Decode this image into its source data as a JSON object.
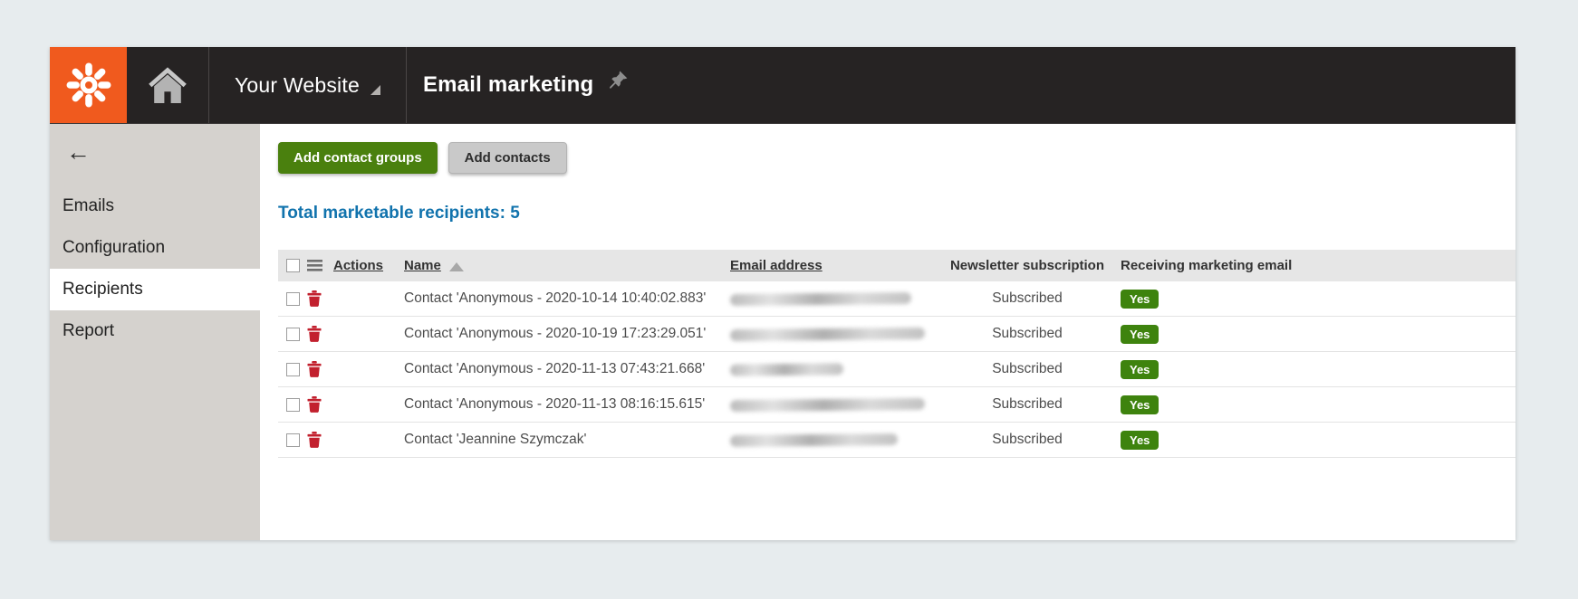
{
  "colors": {
    "brand_orange": "#f05a1e",
    "topbar_bg": "#262323",
    "page_bg": "#e7ecee",
    "sidebar_bg": "#d5d2ce",
    "primary_button_green": "#4a800e",
    "heading_blue": "#1173ad",
    "delete_red": "#c2202e",
    "badge_green": "#3e830e"
  },
  "topbar": {
    "logo_icon": "kentico-flower-icon",
    "home_icon": "home-icon",
    "site_selector_label": "Your Website",
    "app_title": "Email marketing",
    "pin_icon": "pin-icon"
  },
  "sidebar": {
    "back_icon_char": "←",
    "items": [
      {
        "label": "Emails",
        "active": false
      },
      {
        "label": "Configuration",
        "active": false
      },
      {
        "label": "Recipients",
        "active": true
      },
      {
        "label": "Report",
        "active": false
      }
    ]
  },
  "main": {
    "buttons": [
      {
        "label": "Add contact groups",
        "style": "primary"
      },
      {
        "label": "Add contacts",
        "style": "secondary"
      }
    ],
    "summary": "Total marketable recipients: 5",
    "table": {
      "headers": {
        "actions": "Actions",
        "name": "Name",
        "email": "Email address",
        "newsletter": "Newsletter subscription",
        "receiving": "Receiving marketing email"
      },
      "sort": {
        "column": "Name",
        "direction": "asc"
      },
      "rows": [
        {
          "name": "Contact 'Anonymous - 2020-10-14 10:40:02.883'",
          "email_redacted": true,
          "redaction_width": 200,
          "newsletter": "Subscribed",
          "receiving": "Yes"
        },
        {
          "name": "Contact 'Anonymous - 2020-10-19 17:23:29.051'",
          "email_redacted": true,
          "redaction_width": 215,
          "newsletter": "Subscribed",
          "receiving": "Yes"
        },
        {
          "name": "Contact 'Anonymous - 2020-11-13 07:43:21.668'",
          "email_redacted": true,
          "redaction_width": 125,
          "newsletter": "Subscribed",
          "receiving": "Yes"
        },
        {
          "name": "Contact 'Anonymous - 2020-11-13 08:16:15.615'",
          "email_redacted": true,
          "redaction_width": 215,
          "newsletter": "Subscribed",
          "receiving": "Yes"
        },
        {
          "name": "Contact 'Jeannine Szymczak'",
          "email_redacted": true,
          "redaction_width": 185,
          "newsletter": "Subscribed",
          "receiving": "Yes"
        }
      ]
    }
  }
}
